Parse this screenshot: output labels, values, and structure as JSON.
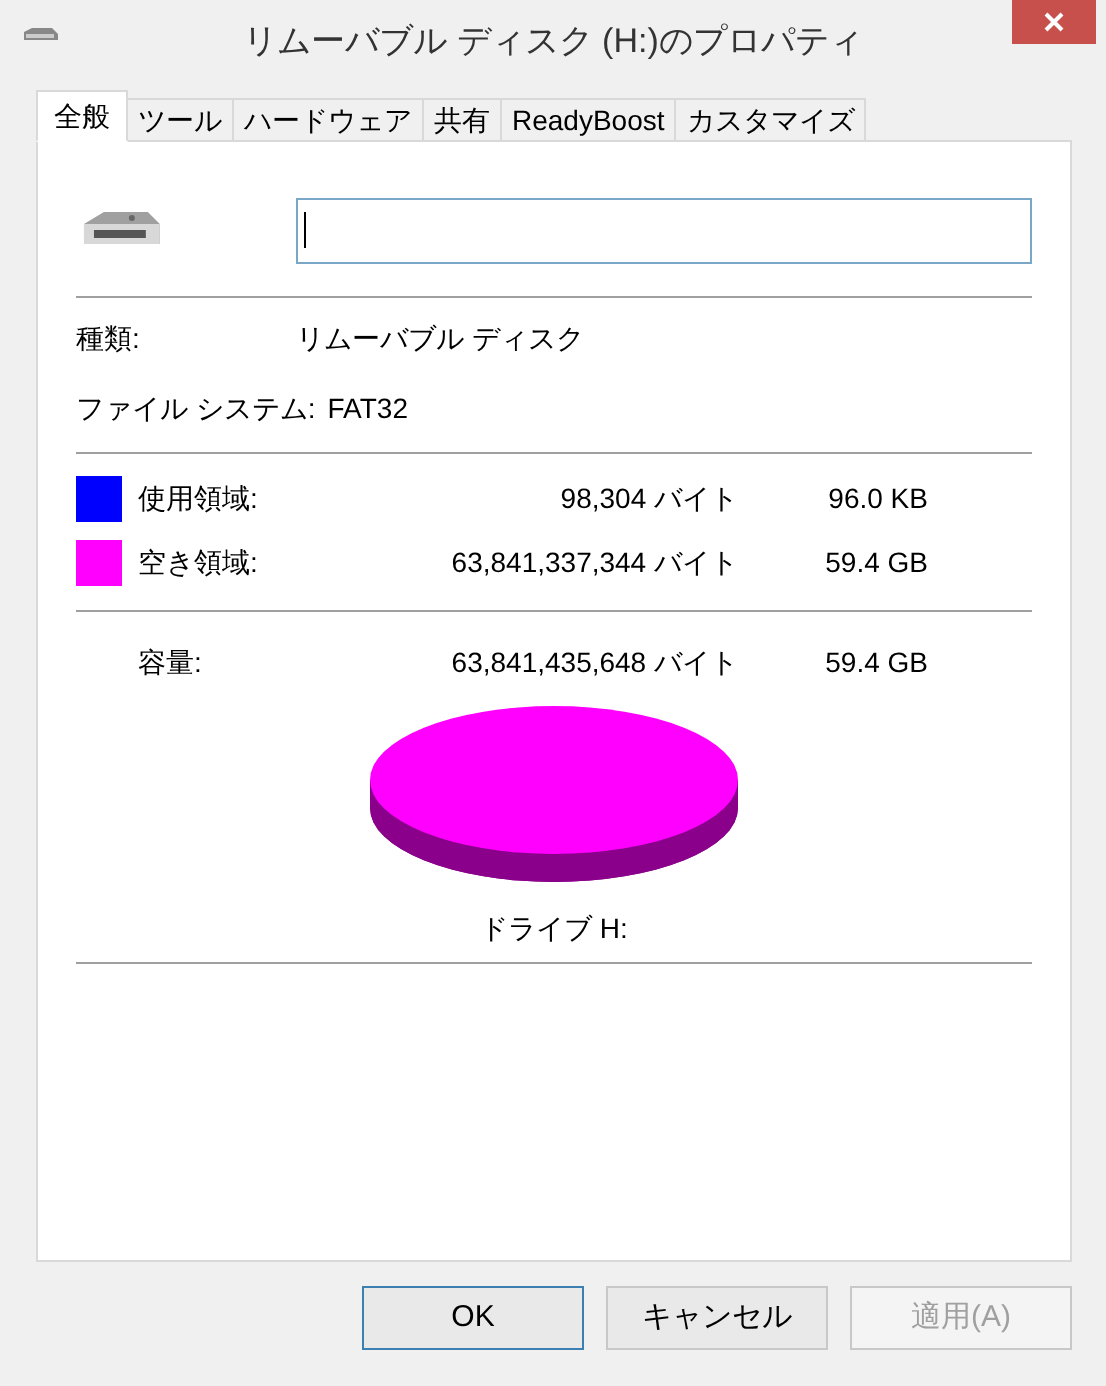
{
  "window": {
    "title": "リムーバブル ディスク (H:)のプロパティ"
  },
  "tabs": [
    {
      "label": "全般",
      "selected": true
    },
    {
      "label": "ツール",
      "selected": false
    },
    {
      "label": "ハードウェア",
      "selected": false
    },
    {
      "label": "共有",
      "selected": false
    },
    {
      "label": "ReadyBoost",
      "selected": false
    },
    {
      "label": "カスタマイズ",
      "selected": false
    }
  ],
  "info": [
    {
      "label": "種類:",
      "value": "リムーバブル ディスク"
    },
    {
      "label": "ファイル システム:",
      "value": "FAT32"
    }
  ],
  "space": [
    {
      "label": "使用領域:",
      "color": "#0000ff",
      "bytes": "98,304 バイト",
      "size": "96.0 KB"
    },
    {
      "label": "空き領域:",
      "color": "#ff00ff",
      "bytes": "63,841,337,344 バイト",
      "size": "59.4 GB"
    }
  ],
  "capacity": {
    "label": "容量:",
    "bytes": "63,841,435,648 バイト",
    "size": "59.4 GB"
  },
  "drive_label": "ドライブ H:",
  "buttons": [
    {
      "label": "OK",
      "kind": "default",
      "disabled": false
    },
    {
      "label": "キャンセル",
      "kind": "normal",
      "disabled": false
    },
    {
      "label": "適用(A)",
      "kind": "normal",
      "disabled": true
    }
  ]
}
